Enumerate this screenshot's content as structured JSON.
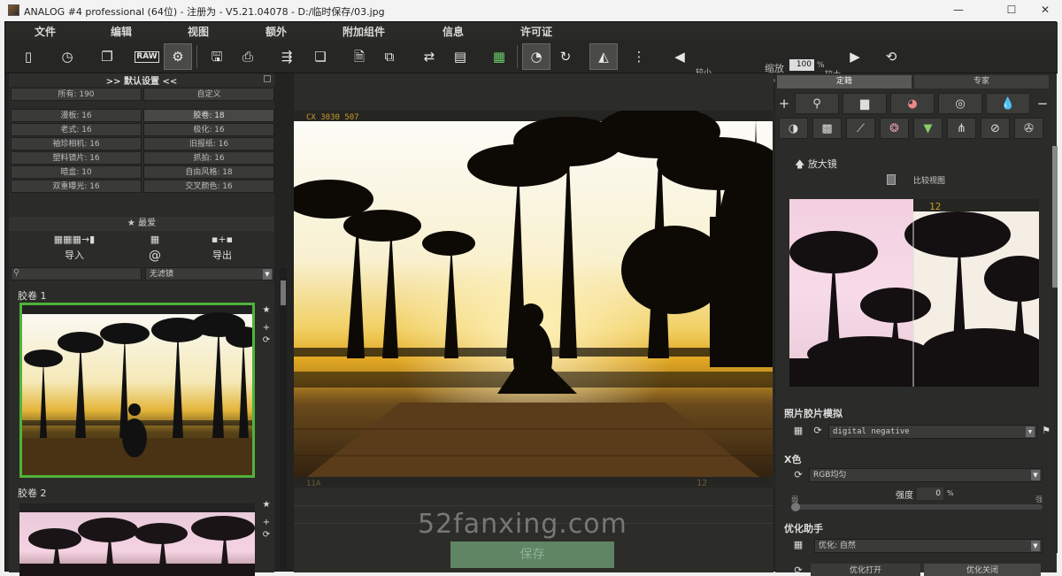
{
  "window": {
    "title": "ANALOG #4 professional (64位) - 注册为 - V5.21.04078 - D:/临时保存/03.jpg",
    "min_icon": "minimize-icon",
    "max_icon": "maximize-icon",
    "close_icon": "close-icon"
  },
  "menu": [
    "文件",
    "编辑",
    "视图",
    "额外",
    "附加组件",
    "信息",
    "许可证"
  ],
  "toolbar": {
    "icons": [
      "new-doc-icon",
      "clock-icon",
      "copy-icon",
      "raw-icon",
      "settings-icon",
      "save-icon",
      "print-icon",
      "export-icon",
      "layers-icon",
      "pdf-icon",
      "batch-icon",
      "compare-icon",
      "info-icon",
      "histogram-icon",
      "history-icon",
      "redo-icon",
      "mirror-icon",
      "grid-icon",
      "flip-icon"
    ],
    "raw_label": "RAW",
    "zoom_label": "缩放",
    "zoom_value": "100",
    "zoom_unit": "%",
    "smaller": "较小",
    "larger": "较大"
  },
  "left": {
    "header": ">> 默认设置 <<",
    "presets": [
      [
        "所有: 190",
        "自定义"
      ],
      [
        "漫板: 16",
        "胶卷: 18"
      ],
      [
        "老式: 16",
        "极化: 16"
      ],
      [
        "袖珍相机: 16",
        "旧报纸: 16"
      ],
      [
        "塑料镜片: 16",
        "抓拍: 16"
      ],
      [
        "暗盒: 10",
        "自由风格: 18"
      ],
      [
        "双重曝光: 16",
        "交叉颜色: 16"
      ]
    ],
    "favorites": "★ 最爱",
    "import": "导入",
    "export": "导出",
    "filter": "无滤镜",
    "films": [
      "胶卷 1",
      "胶卷 2"
    ]
  },
  "center": {
    "film_left": "CX 3030 507",
    "film_right": "12",
    "bottom_left": "11A",
    "bottom_right": "12",
    "watermark": "52fanxing.com",
    "save": "保存"
  },
  "right": {
    "tabs": [
      "定籍",
      "专家"
    ],
    "magnifier": "放大镜",
    "compare": "比较视图",
    "mag_frame_num": "12",
    "section_film": "照片胶片模拟",
    "film_preset": "digital negative",
    "section_color": "X色",
    "color_preset": "RGB均匀",
    "strength_label": "强度",
    "strength_value": "0",
    "strength_unit": "%",
    "weak": "弱",
    "strong": "强",
    "section_opt": "优化助手",
    "opt_preset": "优化: 自然",
    "opt_on": "优化打开",
    "opt_off": "优化关闭",
    "plus": "+",
    "minus": "−"
  }
}
